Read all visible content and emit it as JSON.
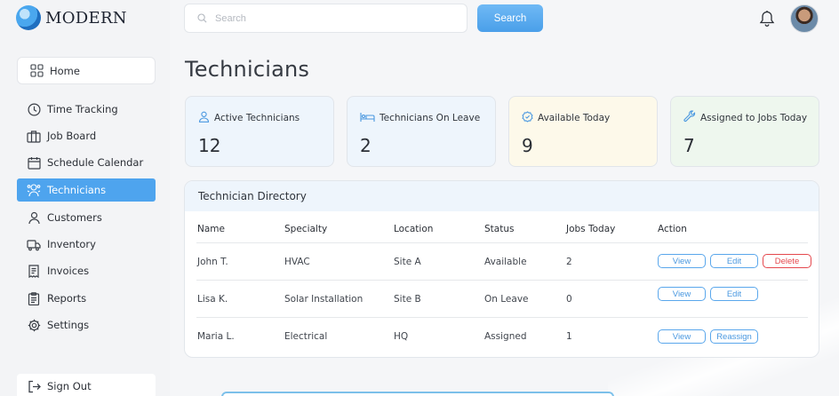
{
  "app": {
    "name": "MODERN"
  },
  "sidebar": {
    "home": "Home",
    "items": [
      {
        "label": "Time Tracking",
        "icon": "clock-icon"
      },
      {
        "label": "Job Board",
        "icon": "briefcase-icon"
      },
      {
        "label": "Schedule Calendar",
        "icon": "calendar-icon"
      },
      {
        "label": "Technicians",
        "icon": "technicians-icon",
        "active": true
      },
      {
        "label": "Customers",
        "icon": "user-icon"
      },
      {
        "label": "Inventory",
        "icon": "truck-icon"
      },
      {
        "label": "Invoices",
        "icon": "invoice-icon"
      },
      {
        "label": "Reports",
        "icon": "clipboard-icon"
      },
      {
        "label": "Settings",
        "icon": "gear-icon"
      }
    ],
    "signout": "Sign Out"
  },
  "header": {
    "search_placeholder": "Search",
    "search_button": "Search"
  },
  "page": {
    "title": "Technicians"
  },
  "stats": [
    {
      "label": "Active Technicians",
      "value": "12",
      "icon": "person-icon"
    },
    {
      "label": "Technicians On Leave",
      "value": "2",
      "icon": "bed-icon"
    },
    {
      "label": "Available Today",
      "value": "9",
      "icon": "check-badge-icon"
    },
    {
      "label": "Assigned to Jobs Today",
      "value": "7",
      "icon": "wrench-icon"
    }
  ],
  "directory": {
    "title": "Technician Directory",
    "columns": [
      "Name",
      "Specialty",
      "Location",
      "Status",
      "Jobs Today",
      "Action"
    ],
    "rows": [
      {
        "name": "John T.",
        "specialty": "HVAC",
        "location": "Site A",
        "status": "Available",
        "jobs": "2",
        "actions": [
          "View",
          "Edit",
          "Delete"
        ]
      },
      {
        "name": "Lisa K.",
        "specialty": "Solar Installation",
        "location": "Site B",
        "status": "On Leave",
        "jobs": "0",
        "actions": [
          "View",
          "Edit"
        ]
      },
      {
        "name": "Maria L.",
        "specialty": "Electrical",
        "location": "HQ",
        "status": "Assigned",
        "jobs": "1",
        "actions": [
          "View",
          "Reassign"
        ]
      }
    ]
  },
  "colors": {
    "accent": "#4ea4ee",
    "danger": "#e5484d"
  }
}
